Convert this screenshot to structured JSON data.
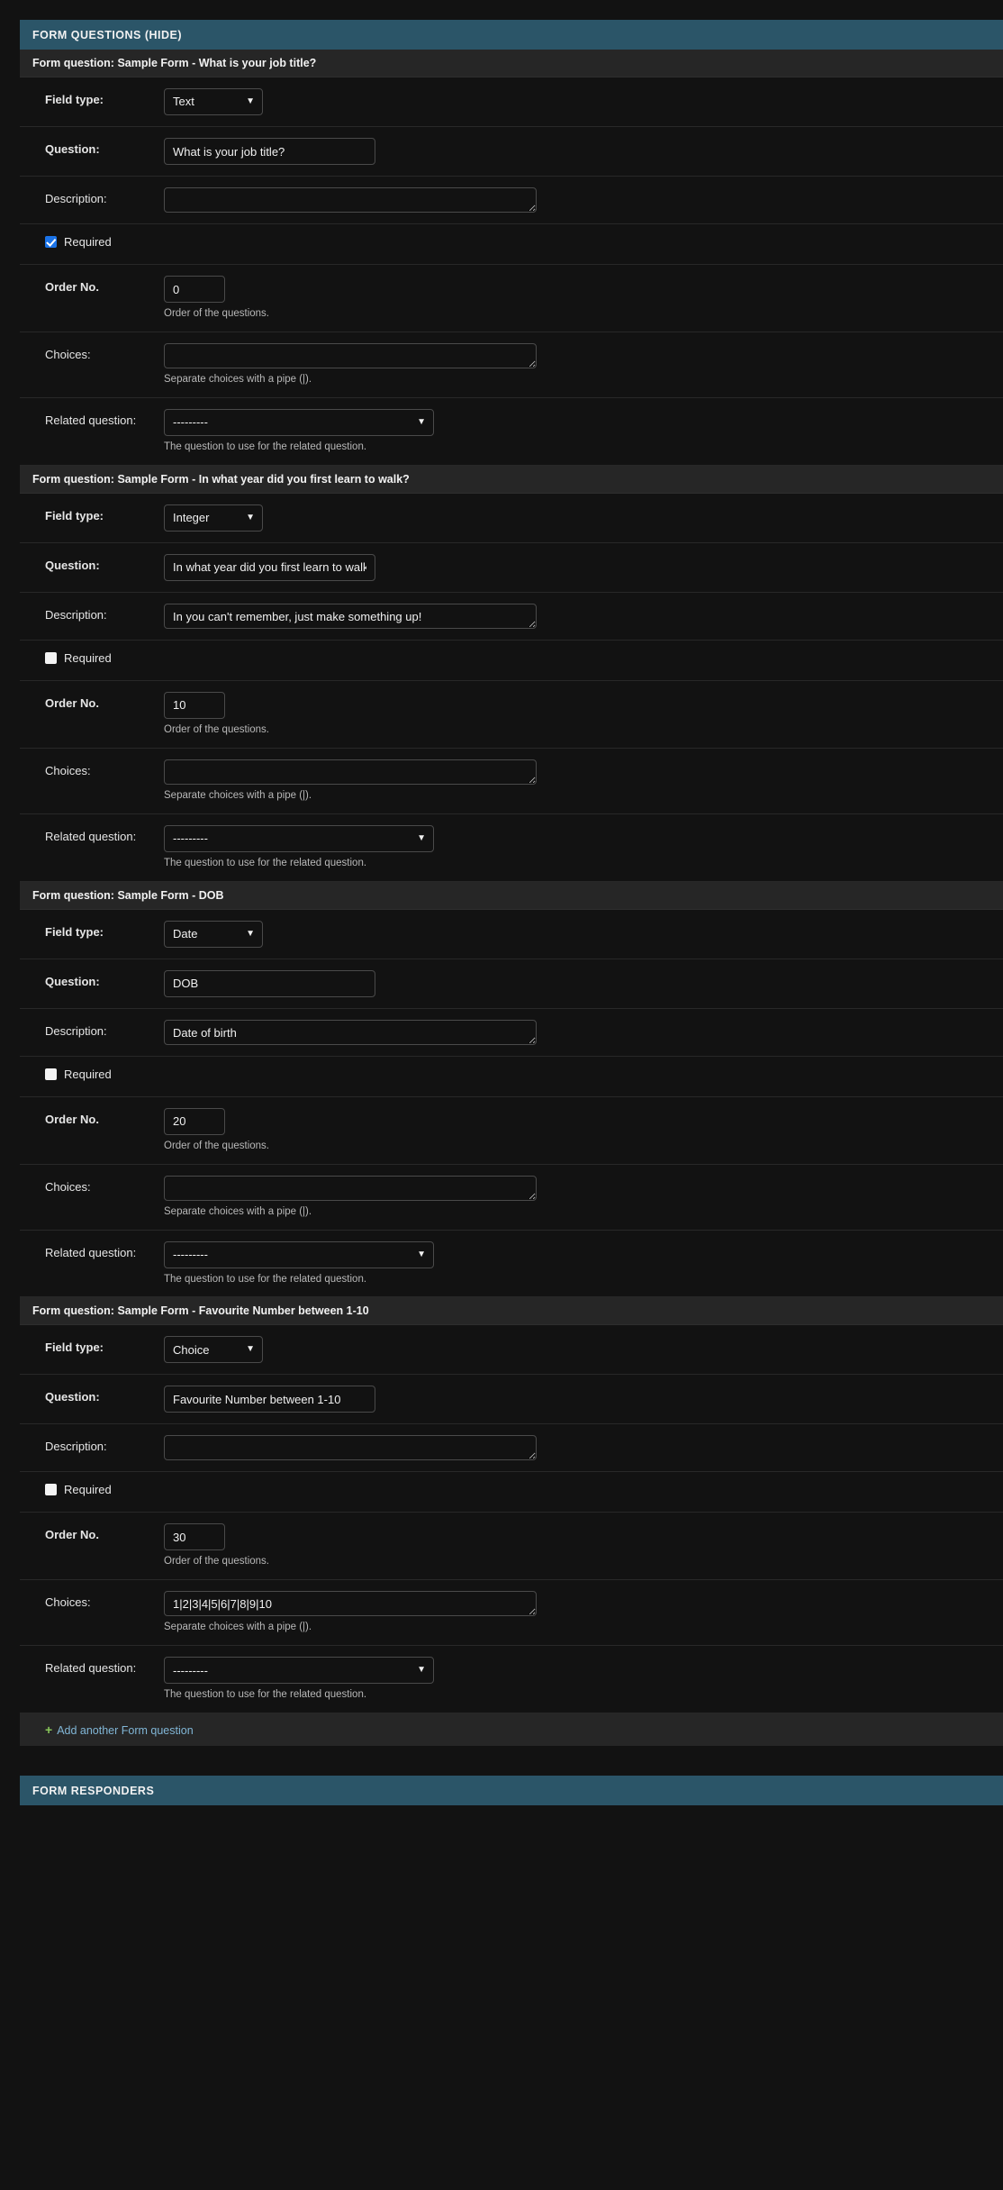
{
  "theme": {
    "page_bg": "#121212",
    "module_bg": "#1b1b1b",
    "header_bg": "#2b5568",
    "inline_title_bg": "#262626",
    "accent_link": "#81b6d6",
    "checkbox_checked": "#1a73e8",
    "add_plus": "#88c65a"
  },
  "questions_module": {
    "header_label": "FORM QUESTIONS (HIDE)",
    "add_another_label": "Add another Form question",
    "add_icon": "plus-icon",
    "labels": {
      "field_type": "Field type:",
      "question": "Question:",
      "description": "Description:",
      "required": "Required",
      "order_no": "Order No.",
      "choices": "Choices:",
      "related_question": "Related question:"
    },
    "help": {
      "order_no": "Order of the questions.",
      "choices": "Separate choices with a pipe (|).",
      "related_question": "The question to use for the related question."
    },
    "field_type_options": [
      "Text",
      "Integer",
      "Date",
      "Choice"
    ],
    "related_question_options": [
      "---------"
    ],
    "items": [
      {
        "title": "Form question: Sample Form - What is your job title?",
        "field_type": "Text",
        "question": "What is your job title?",
        "description": "",
        "required": true,
        "order_no": "0",
        "choices": "",
        "related_question": "---------"
      },
      {
        "title": "Form question: Sample Form - In what year did you first learn to walk?",
        "field_type": "Integer",
        "question": "In what year did you first learn to walk?",
        "description": "In you can't remember, just make something up!",
        "required": false,
        "order_no": "10",
        "choices": "",
        "related_question": "---------"
      },
      {
        "title": "Form question: Sample Form - DOB",
        "field_type": "Date",
        "question": "DOB",
        "description": "Date of birth",
        "required": false,
        "order_no": "20",
        "choices": "",
        "related_question": "---------"
      },
      {
        "title": "Form question: Sample Form - Favourite Number between 1-10",
        "field_type": "Choice",
        "question": "Favourite Number between 1-10",
        "description": "",
        "required": false,
        "order_no": "30",
        "choices": "1|2|3|4|5|6|7|8|9|10",
        "related_question": "---------"
      }
    ]
  },
  "responders_module": {
    "header_label": "FORM RESPONDERS"
  }
}
